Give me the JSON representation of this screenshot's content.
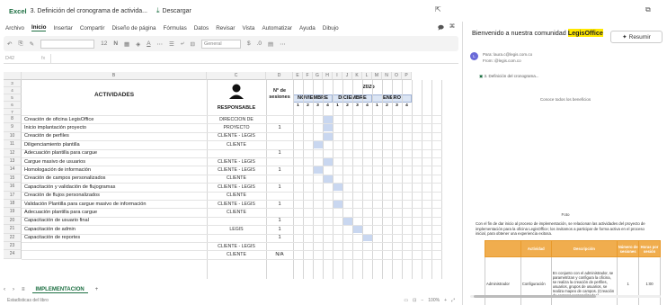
{
  "titlebar": {
    "brand": "Excel",
    "doc_title": "3. Definición del cronograma de activida...",
    "download": "Descargar"
  },
  "ribbon": {
    "tabs": [
      "Archivo",
      "Inicio",
      "Insertar",
      "Compartir",
      "Diseño de página",
      "Fórmulas",
      "Datos",
      "Revisar",
      "Vista",
      "Automatizar",
      "Ayuda",
      "Dibujo"
    ],
    "active_index": 1
  },
  "toolbar": {
    "number_format": "General",
    "font_size": "12"
  },
  "formula": {
    "namebox": "D42",
    "fx": "fx"
  },
  "grid": {
    "col_letters": [
      "B",
      "C",
      "D",
      "E",
      "F",
      "G",
      "H",
      "I",
      "J",
      "K",
      "L",
      "M",
      "N",
      "O",
      "P"
    ],
    "header": {
      "actividades": "ACTIVIDADES",
      "responsable": "RESPONSABLE",
      "sesiones": "N° de sesiones",
      "year": "2025",
      "months": [
        "NOVIEMBRE",
        "DICIEMBRE",
        "ENERO"
      ],
      "weeks": [
        "1",
        "2",
        "3",
        "4",
        "1",
        "2",
        "3",
        "4",
        "1",
        "2",
        "3",
        "4"
      ]
    },
    "rows": [
      {
        "num": "8",
        "activity": "Creación de oficina LegisOffice",
        "responsible": "DIRECCIÓN DE",
        "sessions": ""
      },
      {
        "num": "9",
        "activity": "Inicio implantación proyecto",
        "responsible": "PROYECTO",
        "sessions": "1"
      },
      {
        "num": "10",
        "activity": "Creación de perfiles",
        "responsible": "CLIENTE - LEGIS",
        "sessions": ""
      },
      {
        "num": "11",
        "activity": "Diligenciamiento plantilla",
        "responsible": "CLIENTE",
        "sessions": ""
      },
      {
        "num": "12",
        "activity": "Adecuación plantilla para cargue",
        "responsible": "",
        "sessions": "1"
      },
      {
        "num": "13",
        "activity": "Cargue masivo de usuarios",
        "responsible": "CLIENTE - LEGIS",
        "sessions": ""
      },
      {
        "num": "14",
        "activity": "Homologación de información",
        "responsible": "CLIENTE - LEGIS",
        "sessions": "1"
      },
      {
        "num": "15",
        "activity": "Creación de campos personalizados",
        "responsible": "CLIENTE",
        "sessions": ""
      },
      {
        "num": "16",
        "activity": "Capacitación y validación de flujogramas",
        "responsible": "CLIENTE - LEGIS",
        "sessions": "1"
      },
      {
        "num": "17",
        "activity": "Creación de flujos personalizados",
        "responsible": "CLIENTE",
        "sessions": ""
      },
      {
        "num": "18",
        "activity": "Validación Plantilla para cargue masivo de información",
        "responsible": "CLIENTE - LEGIS",
        "sessions": "1"
      },
      {
        "num": "19",
        "activity": "Adecuación plantilla para cargue",
        "responsible": "CLIENTE",
        "sessions": ""
      },
      {
        "num": "20",
        "activity": "Capacitación de usuario final",
        "responsible": "",
        "sessions": "1"
      },
      {
        "num": "21",
        "activity": "Capacitación de admin",
        "responsible": "LEGIS",
        "sessions": "1"
      },
      {
        "num": "22",
        "activity": "Capacitación de reportes",
        "responsible": "",
        "sessions": "1"
      },
      {
        "num": "23",
        "activity": "",
        "responsible": "CLIENTE - LEGIS",
        "sessions": ""
      },
      {
        "num": "24",
        "activity": "",
        "responsible": "CLIENTE",
        "sessions": "N/A"
      }
    ]
  },
  "sheets": {
    "active": "IMPLEMENTACION",
    "add": "+"
  },
  "status": {
    "left": "Estadísticas del libro",
    "zoom": "100%"
  },
  "pane": {
    "greeting_pre": "Bienvenido a nuestra comunidad ",
    "greeting_hl": "LegisOffice",
    "resumir": "Resumir",
    "avatar": "L",
    "sender_line1": "Para: laura.c@legis.com.co",
    "sender_line2": "From: @legis.com.co",
    "attachment": "3. Definición del cronograma...",
    "body_intro": "Conoce todos los beneficios",
    "foto": "Foto",
    "paragraph": "Con el fin de dar inicio al proceso de implementación, se relacionan las actividades del proyecto de implementación para la oficina LegisOffice; los invitamos a participar de forma activa en el proceso inicial, para obtener una experiencia exitosa.",
    "table_headers": [
      "",
      "Actividad",
      "Descripción",
      "Número de sesiones",
      "Horas por sesión"
    ],
    "table_row": [
      "Administrador",
      "Configuración",
      "En conjunto con el administrador, se parametrizan y configura la oficina, se realiza la creación de perfiles, usuarios, grupos de usuarios, se realiza mapeo de campos. (Creación de campos personalizados).",
      "1",
      "1:00"
    ]
  },
  "colors": {
    "excel_green": "#1d6f42",
    "gantt_fill": "#c9d7f0",
    "month_fill": "#dbe5f4",
    "table_header": "#f0ad4e",
    "highlight": "#ffe800"
  }
}
